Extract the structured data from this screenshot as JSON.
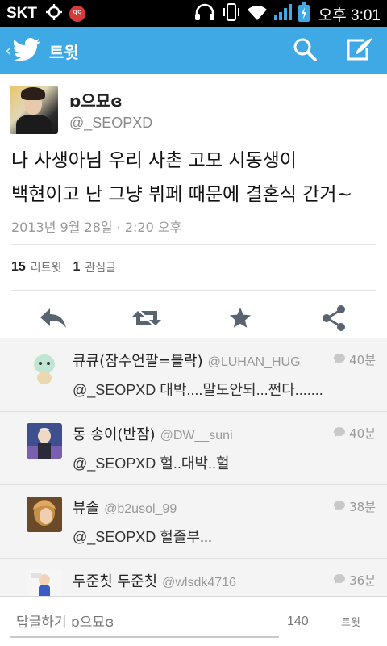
{
  "status_bar": {
    "carrier": "SKT",
    "berry_badge": "99",
    "clock": "오후 3:01",
    "icons": [
      "gps-icon",
      "headphones-icon",
      "vibrate-icon",
      "wifi-icon",
      "signal-icon",
      "battery-charging-icon"
    ]
  },
  "action_bar": {
    "title": "트윗",
    "icons": [
      "back-chevron-icon",
      "twitter-bird-icon",
      "search-icon",
      "compose-icon"
    ],
    "color": "#3fa9e6"
  },
  "tweet": {
    "author_name": "ɒ으묘ɞ",
    "author_handle": "@_SEOPXD",
    "text_line1": "나 사생아님 우리 사촌 고모 시동생이",
    "text_line2": "백현이고 난 그냥 뷔페 때문에 결혼식 간거~",
    "timestamp": "2013년 9월 28일 · 2:20 오후",
    "retweet_count": "15",
    "retweet_label": "리트윗",
    "favorite_count": "1",
    "favorite_label": "관심글",
    "actions": [
      "reply-icon",
      "retweet-icon",
      "favorite-star-icon",
      "share-icon"
    ]
  },
  "replies": [
    {
      "name": "큐큐(잠수언팔=블락)",
      "handle": "@LUHAN_HUG",
      "time": "40분",
      "text": "@_SEOPXD 대박....말도안되...쩐다......."
    },
    {
      "name": "동 송이(반잠)",
      "handle": "@DW__suni",
      "time": "40분",
      "text": "@_SEOPXD 헐..대박..헐"
    },
    {
      "name": "뷰솔",
      "handle": "@b2usol_99",
      "time": "38분",
      "text": "@_SEOPXD 헐졸부..."
    },
    {
      "name": "두준칫 두준칫",
      "handle": "@wlsdk4716",
      "time": "36분",
      "text": ""
    }
  ],
  "compose": {
    "placeholder": "답글하기 ɒ으묘ɞ",
    "char_count": "140",
    "send_label": "트윗"
  }
}
